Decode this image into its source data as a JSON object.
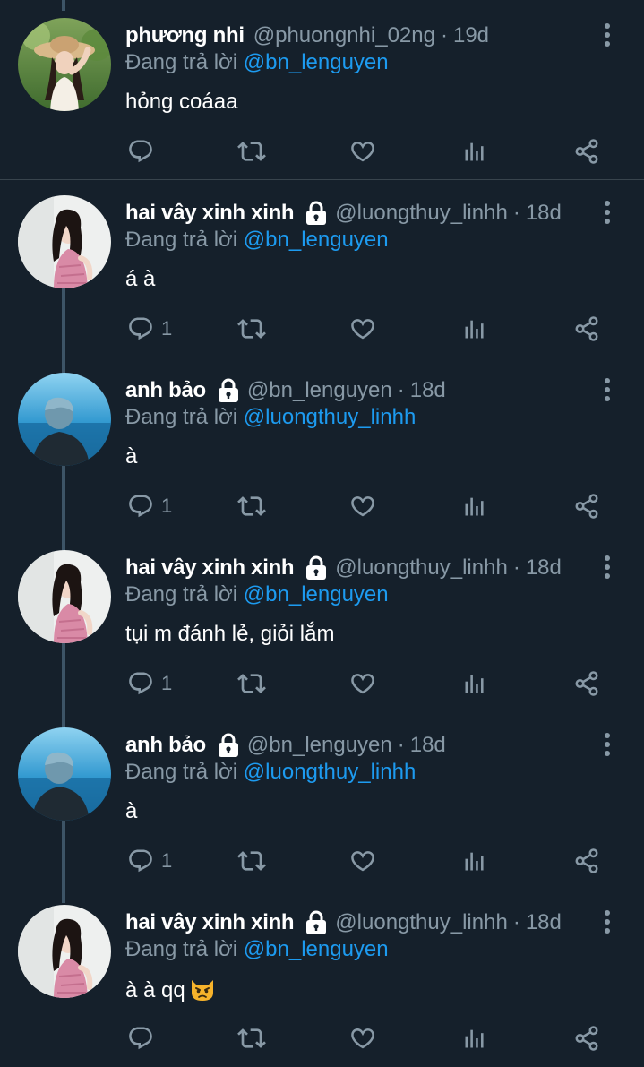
{
  "tweets": [
    {
      "name": "phương nhi",
      "locked": false,
      "handle": "@phuongnhi_02ng",
      "dot": "·",
      "time": "19d",
      "reply_prefix": "Đang trả lời",
      "reply_to": "@bn_lenguyen",
      "text": "hỏng coáaa",
      "reply_count": "",
      "avatar": "avatar-straw-hat-girl"
    },
    {
      "name": "hai vây xinh xinh",
      "locked": true,
      "handle": "@luongthuy_linhh",
      "dot": "·",
      "time": "18d",
      "reply_prefix": "Đang trả lời",
      "reply_to": "@bn_lenguyen",
      "text": "á à",
      "reply_count": "1",
      "avatar": "avatar-pink-shirt-girl"
    },
    {
      "name": "anh bảo",
      "locked": true,
      "handle": "@bn_lenguyen",
      "dot": "·",
      "time": "18d",
      "reply_prefix": "Đang trả lời",
      "reply_to": "@luongthuy_linhh",
      "text": "à",
      "reply_count": "1",
      "avatar": "avatar-ocean-boy"
    },
    {
      "name": "hai vây xinh xinh",
      "locked": true,
      "handle": "@luongthuy_linhh",
      "dot": "·",
      "time": "18d",
      "reply_prefix": "Đang trả lời",
      "reply_to": "@bn_lenguyen",
      "text": "tụi m đánh lẻ, giỏi lắm",
      "reply_count": "1",
      "avatar": "avatar-pink-shirt-girl"
    },
    {
      "name": "anh bảo",
      "locked": true,
      "handle": "@bn_lenguyen",
      "dot": "·",
      "time": "18d",
      "reply_prefix": "Đang trả lời",
      "reply_to": "@luongthuy_linhh",
      "text": "à",
      "reply_count": "1",
      "avatar": "avatar-ocean-boy"
    },
    {
      "name": "hai vây xinh xinh",
      "locked": true,
      "handle": "@luongthuy_linhh",
      "dot": "·",
      "time": "18d",
      "reply_prefix": "Đang trả lời",
      "reply_to": "@bn_lenguyen",
      "text": "à à qq",
      "reply_count": "",
      "emoji": "pouting-cat-emoji",
      "avatar": "avatar-pink-shirt-girl"
    }
  ],
  "icons": {
    "reply": "comment-icon",
    "retweet": "retweet-icon",
    "like": "heart-icon",
    "views": "bar-chart-icon",
    "share": "share-icon",
    "more": "more-vertical-icon",
    "lock": "lock-icon"
  },
  "colors": {
    "background": "#15202b",
    "muted": "#8899a6",
    "link": "#1d9bf0",
    "thread_line": "#3d5466"
  }
}
